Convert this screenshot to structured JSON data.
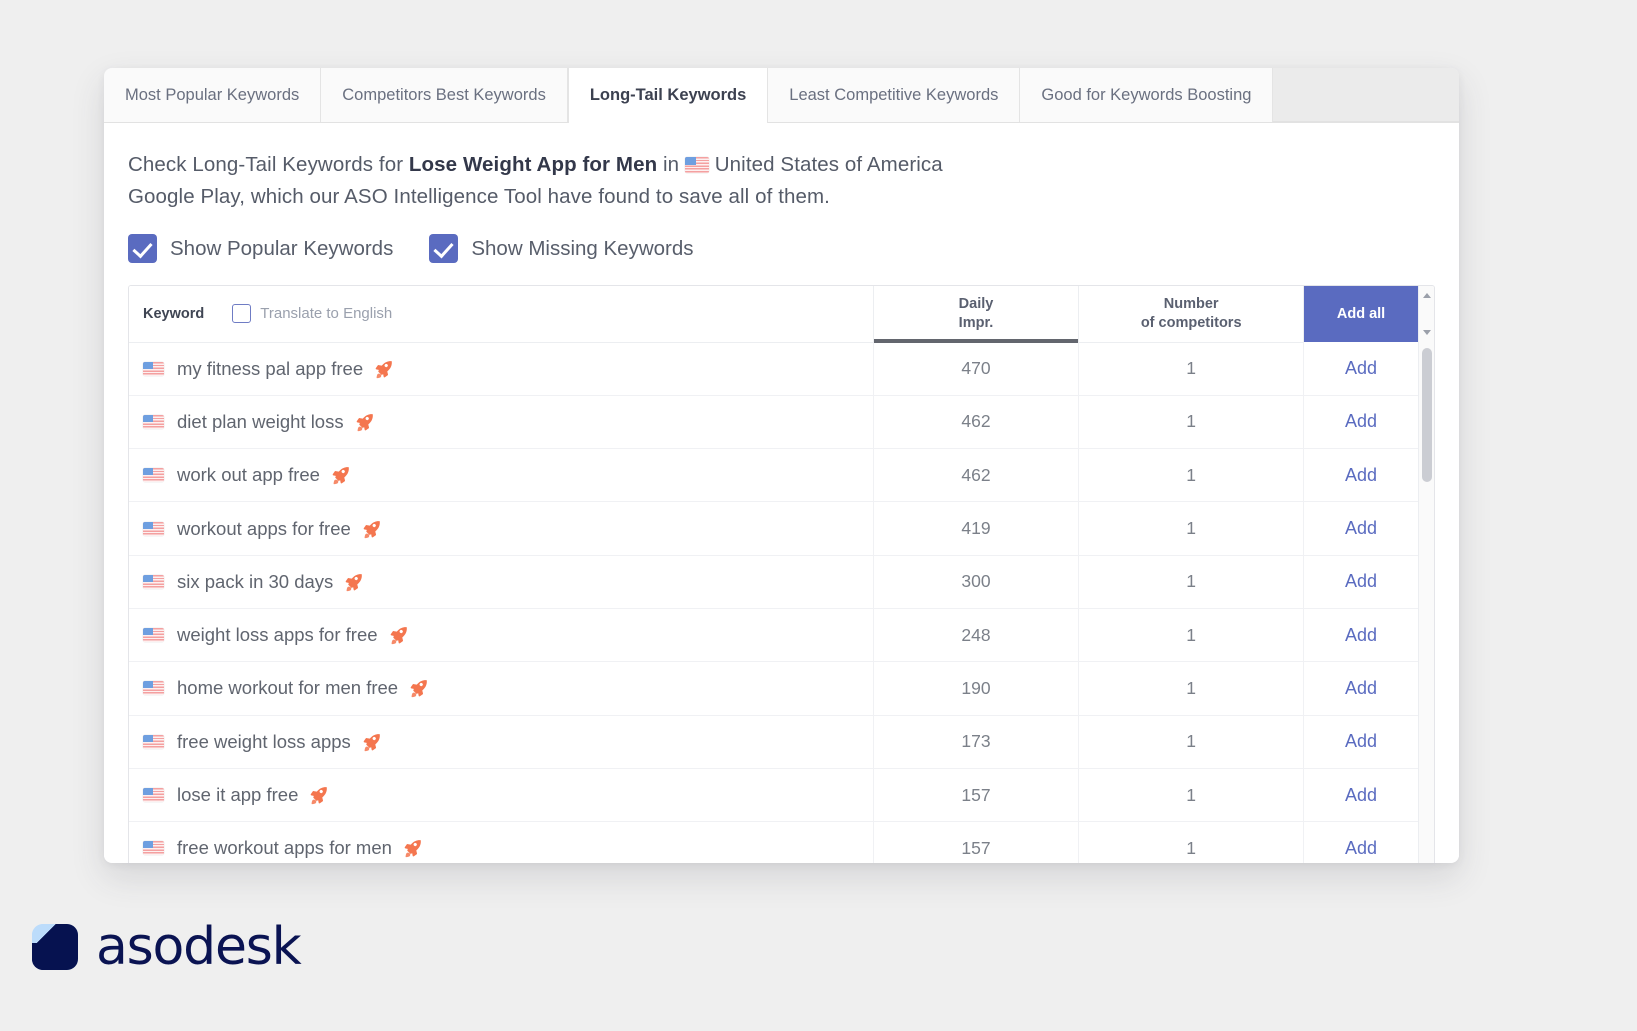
{
  "tabs": [
    {
      "label": "Most Popular Keywords",
      "active": false
    },
    {
      "label": "Competitors Best Keywords",
      "active": false
    },
    {
      "label": "Long-Tail Keywords",
      "active": true
    },
    {
      "label": "Least Competitive Keywords",
      "active": false
    },
    {
      "label": "Good for Keywords Boosting",
      "active": false
    }
  ],
  "description": {
    "prefix": "Check Long-Tail Keywords for ",
    "app_name": "Lose Weight App for Men",
    "mid": " in ",
    "country": "United States of America",
    "line2": "Google Play, which our ASO Intelligence Tool have found to save all of them.",
    "flag_icon": "us-flag-icon"
  },
  "filters": [
    {
      "label": "Show Popular Keywords",
      "checked": true
    },
    {
      "label": "Show Missing Keywords",
      "checked": true
    }
  ],
  "table": {
    "headers": {
      "keyword": "Keyword",
      "translate": "Translate to English",
      "translate_checked": false,
      "daily_impr_line1": "Daily",
      "daily_impr_line2": "Impr.",
      "competitors_line1": "Number",
      "competitors_line2": "of competitors",
      "add_all": "Add all"
    },
    "sorted_column": "daily_impr",
    "add_label": "Add",
    "rows": [
      {
        "flag": "us-flag-icon",
        "keyword": "my fitness pal app free",
        "badge": "rocket-icon",
        "daily_impr": "470",
        "competitors": "1"
      },
      {
        "flag": "us-flag-icon",
        "keyword": "diet plan weight loss",
        "badge": "rocket-icon",
        "daily_impr": "462",
        "competitors": "1"
      },
      {
        "flag": "us-flag-icon",
        "keyword": "work out app free",
        "badge": "rocket-icon",
        "daily_impr": "462",
        "competitors": "1"
      },
      {
        "flag": "us-flag-icon",
        "keyword": "workout apps for free",
        "badge": "rocket-icon",
        "daily_impr": "419",
        "competitors": "1"
      },
      {
        "flag": "us-flag-icon",
        "keyword": "six pack in 30 days",
        "badge": "rocket-icon",
        "daily_impr": "300",
        "competitors": "1"
      },
      {
        "flag": "us-flag-icon",
        "keyword": "weight loss apps for free",
        "badge": "rocket-icon",
        "daily_impr": "248",
        "competitors": "1"
      },
      {
        "flag": "us-flag-icon",
        "keyword": "home workout for men free",
        "badge": "rocket-icon",
        "daily_impr": "190",
        "competitors": "1"
      },
      {
        "flag": "us-flag-icon",
        "keyword": "free weight loss apps",
        "badge": "rocket-icon",
        "daily_impr": "173",
        "competitors": "1"
      },
      {
        "flag": "us-flag-icon",
        "keyword": "lose it app free",
        "badge": "rocket-icon",
        "daily_impr": "157",
        "competitors": "1"
      },
      {
        "flag": "us-flag-icon",
        "keyword": "free workout apps for men",
        "badge": "rocket-icon",
        "daily_impr": "157",
        "competitors": "1"
      }
    ]
  },
  "logo": {
    "text": "asodesk"
  },
  "colors": {
    "accent": "#5a6bc0",
    "rocket": "#f4764f",
    "logo_navy": "#0a1352",
    "logo_light": "#bcdcfb",
    "page_bg": "#efefef"
  }
}
